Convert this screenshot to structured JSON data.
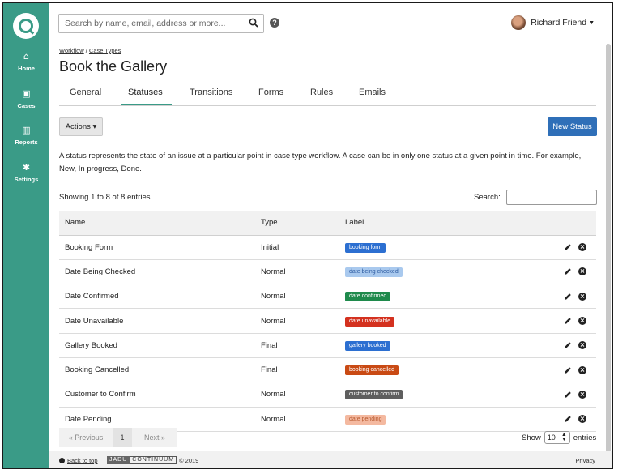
{
  "sidebar": {
    "items": [
      {
        "label": "Home",
        "icon": "home-icon",
        "glyph": "⌂"
      },
      {
        "label": "Cases",
        "icon": "archive-icon",
        "glyph": "▣"
      },
      {
        "label": "Reports",
        "icon": "bar-chart-icon",
        "glyph": "▥"
      },
      {
        "label": "Settings",
        "icon": "gear-icon",
        "glyph": "✱"
      }
    ]
  },
  "header": {
    "search_placeholder": "Search by name, email, address or more...",
    "help_glyph": "?",
    "user_name": "Richard Friend",
    "user_caret": "▼"
  },
  "breadcrumb": {
    "workflow": "Workflow",
    "separator": " / ",
    "case_types": "Case Types"
  },
  "page_title": "Book the Gallery",
  "tabs": [
    {
      "label": "General"
    },
    {
      "label": "Statuses"
    },
    {
      "label": "Transitions"
    },
    {
      "label": "Forms"
    },
    {
      "label": "Rules"
    },
    {
      "label": "Emails"
    }
  ],
  "toolbar": {
    "actions_label": "Actions ▾",
    "new_status_label": "New Status"
  },
  "description": "A status represents the state of an issue at a particular point in case type workflow. A case can be in only one status at a given point in time. For example, New, In progress, Done.",
  "table": {
    "showing": "Showing 1 to 8 of 8 entries",
    "search_label": "Search:",
    "headers": [
      "Name",
      "Type",
      "Label"
    ],
    "rows": [
      {
        "name": "Booking Form",
        "type": "Initial",
        "label": "booking form",
        "color": "#2c6fd1",
        "text_color": "#ffffff"
      },
      {
        "name": "Date Being Checked",
        "type": "Normal",
        "label": "date being checked",
        "color": "#a9c9ee",
        "text_color": "#2c5aa0"
      },
      {
        "name": "Date Confirmed",
        "type": "Normal",
        "label": "date confirmed",
        "color": "#1f8a4c",
        "text_color": "#ffffff"
      },
      {
        "name": "Date Unavailable",
        "type": "Normal",
        "label": "date unavailable",
        "color": "#d4311f",
        "text_color": "#ffffff"
      },
      {
        "name": "Gallery Booked",
        "type": "Final",
        "label": "gallery booked",
        "color": "#2c6fd1",
        "text_color": "#ffffff"
      },
      {
        "name": "Booking Cancelled",
        "type": "Final",
        "label": "booking cancelled",
        "color": "#c94a14",
        "text_color": "#ffffff"
      },
      {
        "name": "Customer to Confirm",
        "type": "Normal",
        "label": "customer to confirm",
        "color": "#5e5e5e",
        "text_color": "#ffffff"
      },
      {
        "name": "Date Pending",
        "type": "Normal",
        "label": "date pending",
        "color": "#f4b9a0",
        "text_color": "#b85a30"
      }
    ]
  },
  "pagination": {
    "previous": "« Previous",
    "page": "1",
    "next": "Next »"
  },
  "show_entries": {
    "show": "Show",
    "value": "10",
    "entries": "entries"
  },
  "footer": {
    "back_to_top": "Back to top",
    "brand_left": "JADU",
    "brand_right": "CONTINUUM",
    "copyright": "© 2019",
    "privacy": "Privacy"
  },
  "colors": {
    "sidebar": "#3a9b87",
    "primary_button": "#2f6fb8",
    "active_tab": "#3a9b87"
  }
}
